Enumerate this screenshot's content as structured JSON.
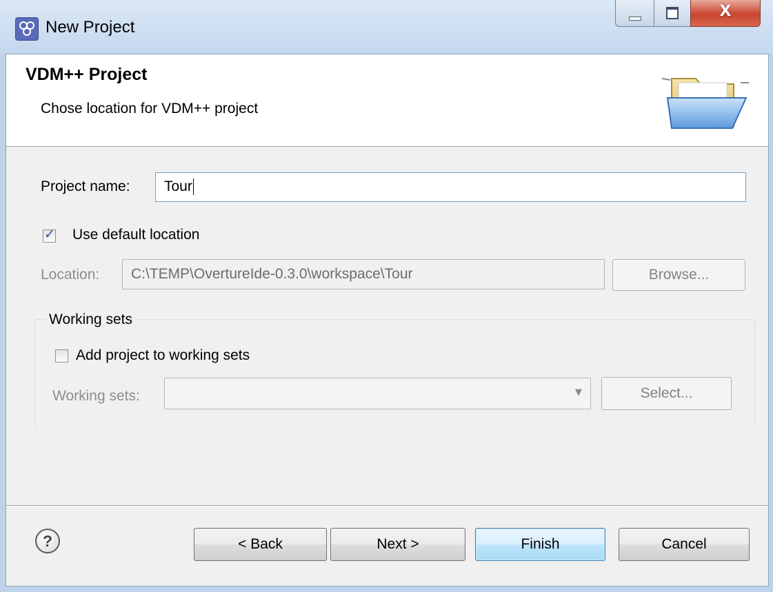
{
  "window": {
    "title": "New Project",
    "close_glyph": "X"
  },
  "banner": {
    "title": "VDM++ Project",
    "description": "Chose location for VDM++ project",
    "icon": "folder-icon"
  },
  "form": {
    "project_name_label": "Project name:",
    "project_name_value": "Tour",
    "use_default_location_label": "Use default location",
    "use_default_location_checked": true,
    "location_label": "Location:",
    "location_value": "C:\\TEMP\\OvertureIde-0.3.0\\workspace\\Tour",
    "browse_label": "Browse..."
  },
  "working_sets_group": {
    "title": "Working sets",
    "add_to_working_sets_label": "Add project to working sets",
    "add_to_working_sets_checked": false,
    "working_sets_label": "Working sets:",
    "working_sets_value": "",
    "select_label": "Select..."
  },
  "footer": {
    "help_glyph": "?",
    "back_label": "< Back",
    "next_label": "Next >",
    "finish_label": "Finish",
    "cancel_label": "Cancel"
  },
  "colors": {
    "titlebar": "#c3d7ee",
    "close_button": "#c9442e",
    "default_button_border": "#3c7fb1",
    "checkbox_tick": "#2a4c93"
  }
}
